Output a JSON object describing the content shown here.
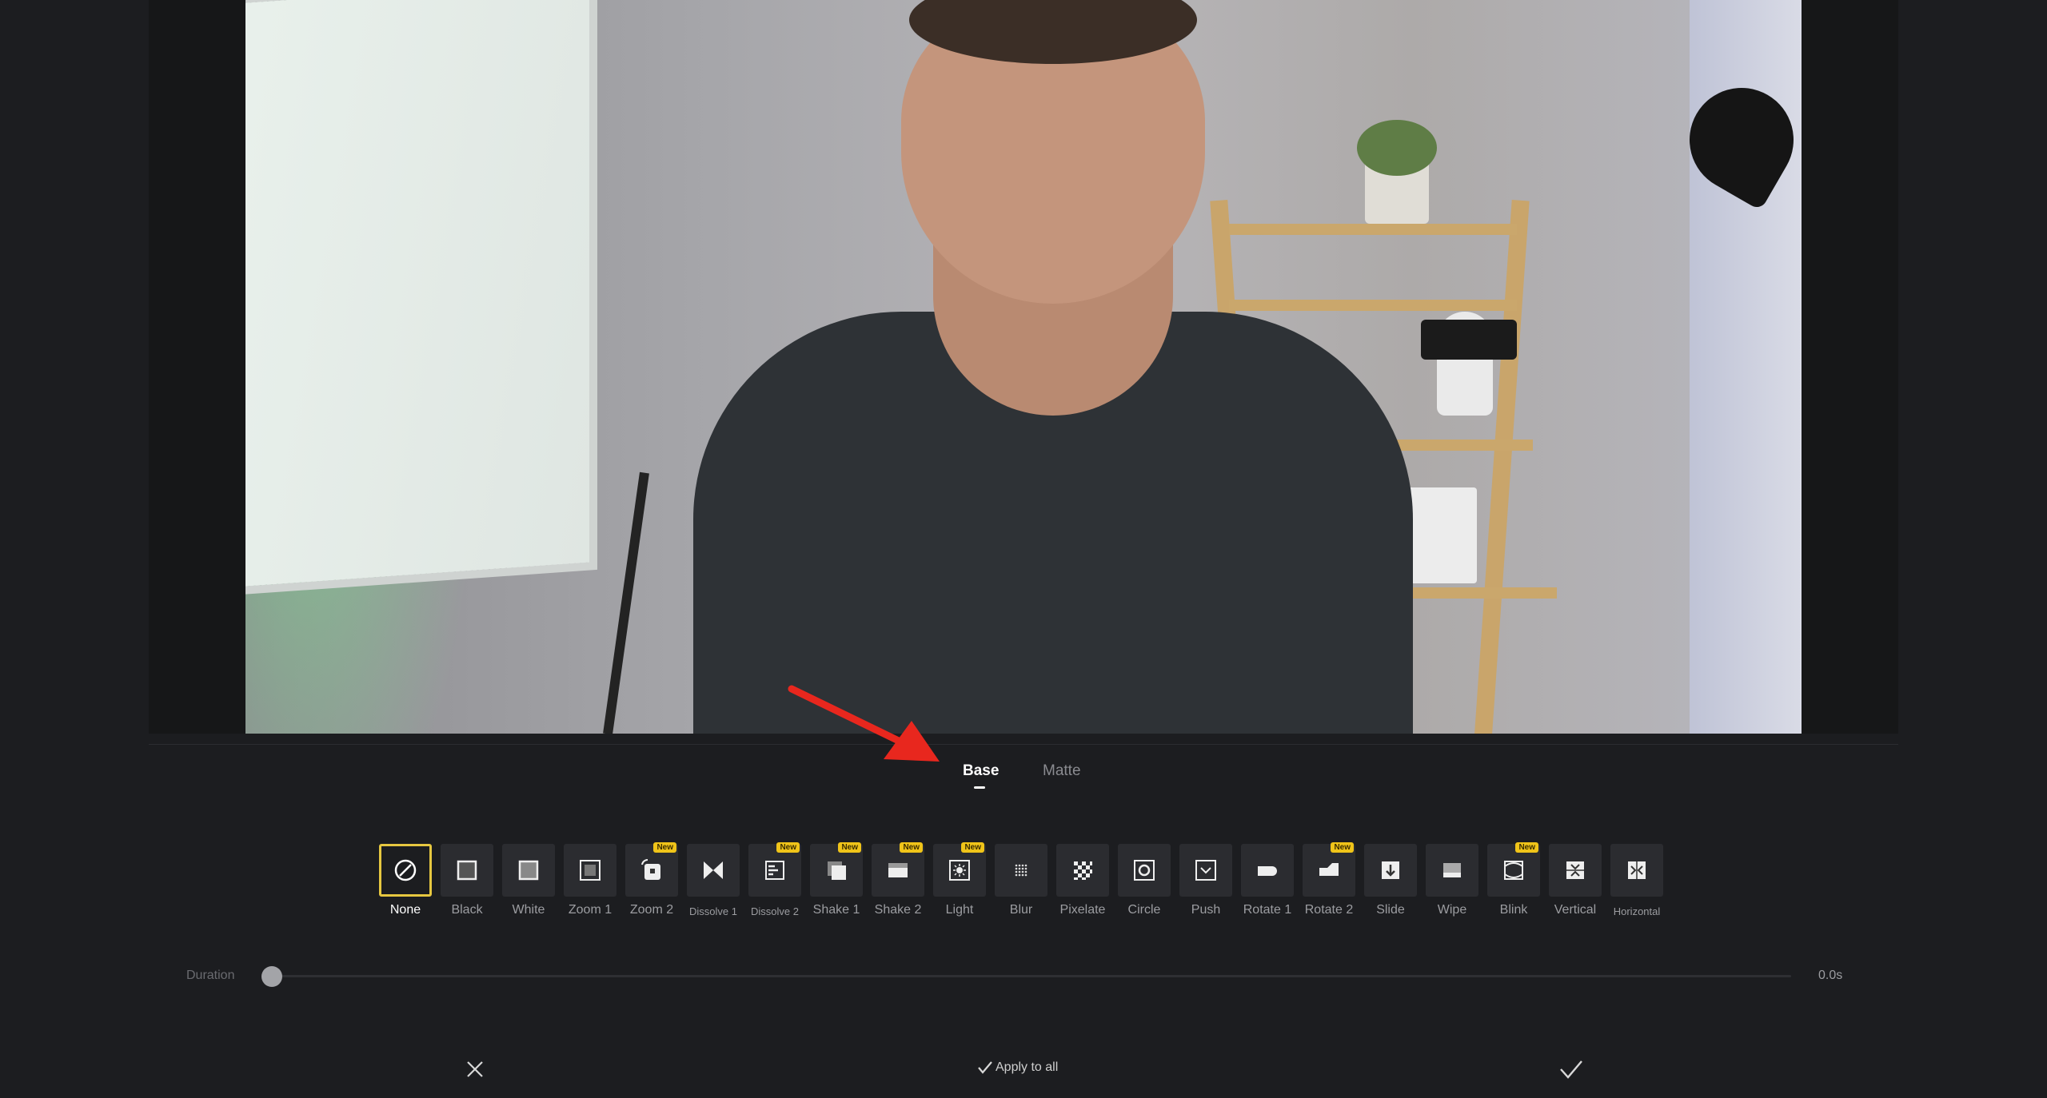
{
  "tabs": [
    {
      "label": "Base",
      "active": true
    },
    {
      "label": "Matte",
      "active": false
    }
  ],
  "transitions": [
    {
      "label": "None",
      "icon": "none-icon",
      "selected": true,
      "new": false
    },
    {
      "label": "Black",
      "icon": "black-fade-icon",
      "new": false
    },
    {
      "label": "White",
      "icon": "white-fade-icon",
      "new": false
    },
    {
      "label": "Zoom 1",
      "icon": "zoom1-icon",
      "new": false
    },
    {
      "label": "Zoom 2",
      "icon": "zoom2-icon",
      "new": true
    },
    {
      "label": "Dissolve 1",
      "icon": "dissolve1-icon",
      "new": false
    },
    {
      "label": "Dissolve 2",
      "icon": "dissolve2-icon",
      "new": true
    },
    {
      "label": "Shake 1",
      "icon": "shake1-icon",
      "new": true
    },
    {
      "label": "Shake 2",
      "icon": "shake2-icon",
      "new": true
    },
    {
      "label": "Light",
      "icon": "light-icon",
      "new": true
    },
    {
      "label": "Blur",
      "icon": "blur-icon",
      "new": false
    },
    {
      "label": "Pixelate",
      "icon": "pixelate-icon",
      "new": false
    },
    {
      "label": "Circle",
      "icon": "circle-icon",
      "new": false
    },
    {
      "label": "Push",
      "icon": "push-icon",
      "new": false
    },
    {
      "label": "Rotate 1",
      "icon": "rotate1-icon",
      "new": false
    },
    {
      "label": "Rotate 2",
      "icon": "rotate2-icon",
      "new": true
    },
    {
      "label": "Slide",
      "icon": "slide-icon",
      "new": false
    },
    {
      "label": "Wipe",
      "icon": "wipe-icon",
      "new": false
    },
    {
      "label": "Blink",
      "icon": "blink-icon",
      "new": true
    },
    {
      "label": "Vertical",
      "icon": "vertical-icon",
      "new": false
    },
    {
      "label": "Horizontal",
      "icon": "horizontal-icon",
      "new": false
    }
  ],
  "new_badge": "New",
  "duration": {
    "label": "Duration",
    "value_text": "0.0s",
    "fraction": 0.0
  },
  "actions": {
    "apply_all_label": "Apply to all"
  },
  "colors": {
    "accent": "#e6c740",
    "badge": "#f0c419",
    "annotation_arrow": "#e8271e"
  }
}
